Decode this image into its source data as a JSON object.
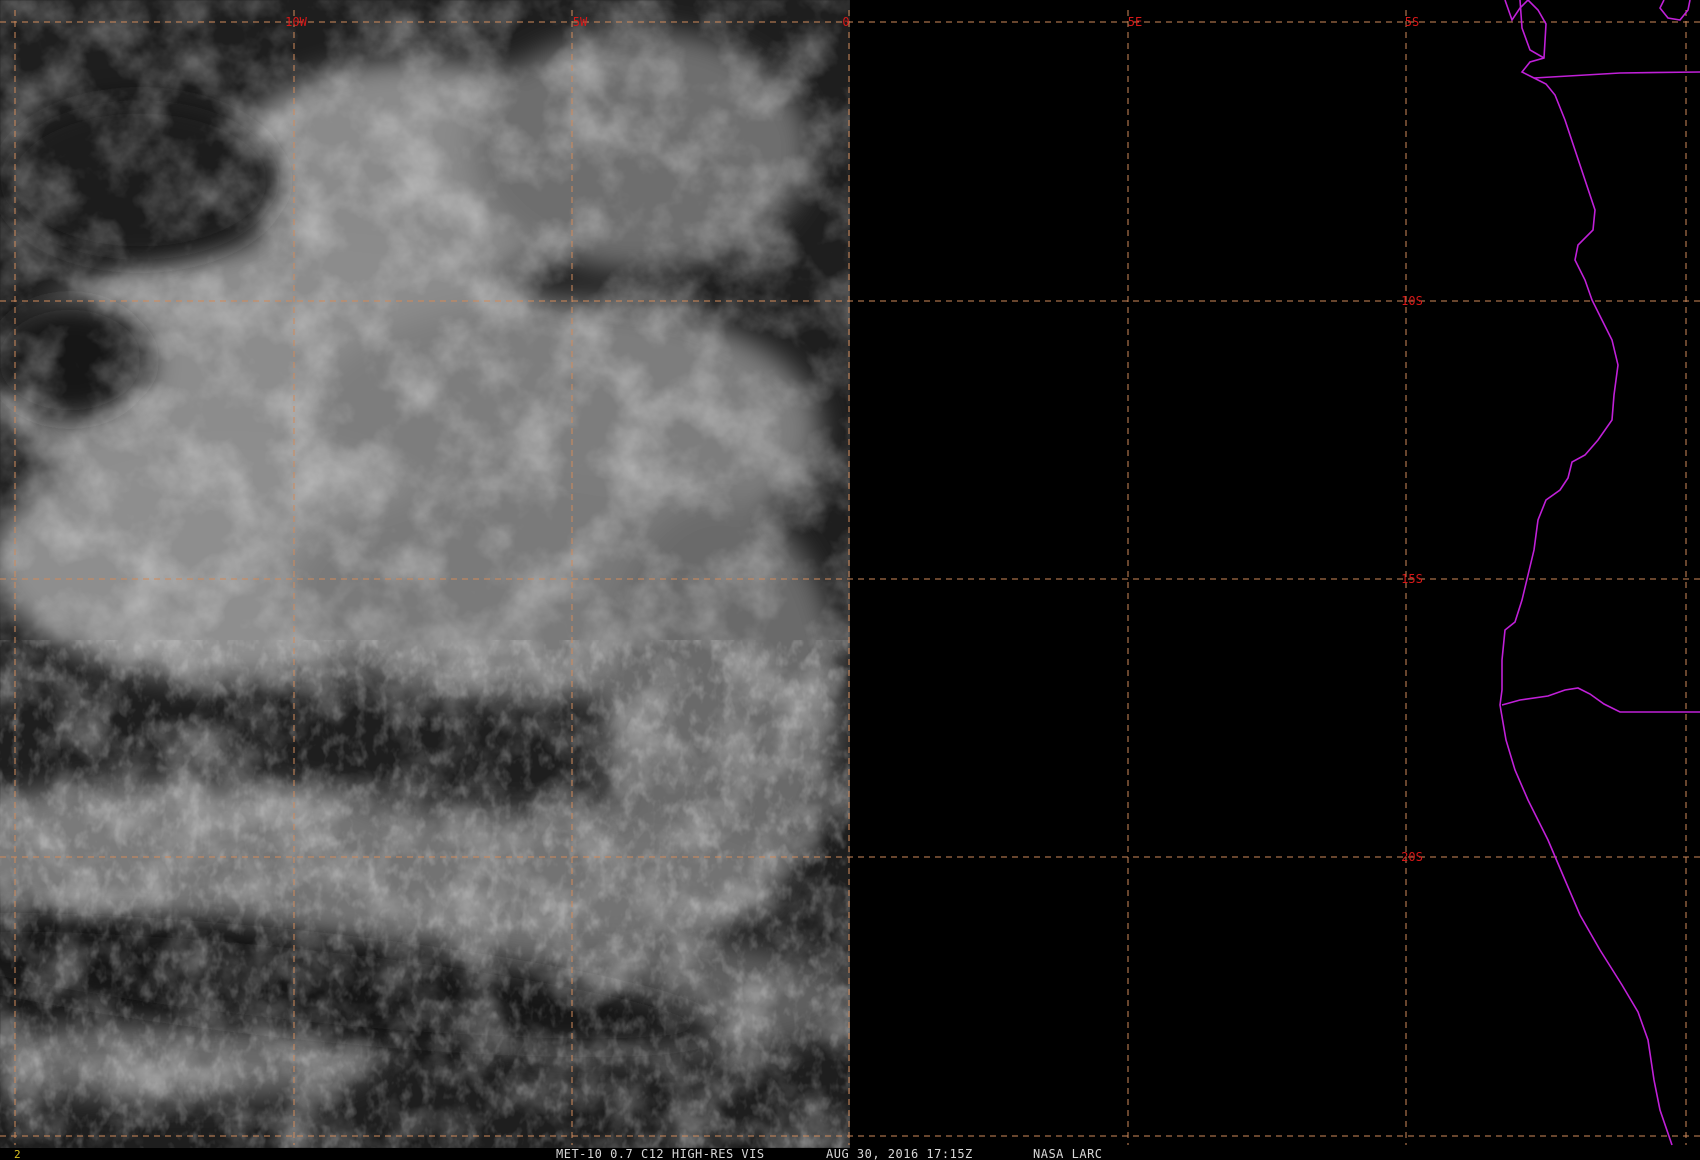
{
  "image": {
    "product": "MET-10 0.7 C12 HIGH-RES VIS",
    "datetime": "AUG 30, 2016 17:15Z",
    "source": "NASA LARC",
    "frame_number": "2"
  },
  "colors": {
    "background": "#000000",
    "gridline": "#d08a5a",
    "grid_label": "#d81818",
    "coastline": "#c020d8",
    "status_text": "#d8d8d8",
    "frame_number": "#d8c020"
  },
  "grid": {
    "longitude_labels": [
      "10W",
      "5W",
      "0",
      "5E"
    ],
    "latitude_labels": [
      "5S",
      "10S",
      "15S",
      "20S"
    ]
  },
  "map": {
    "type": "satellite visible imagery",
    "region": "South Atlantic / west coast of Africa",
    "overlay": [
      "lat-lon grid",
      "coastline and borders"
    ]
  }
}
